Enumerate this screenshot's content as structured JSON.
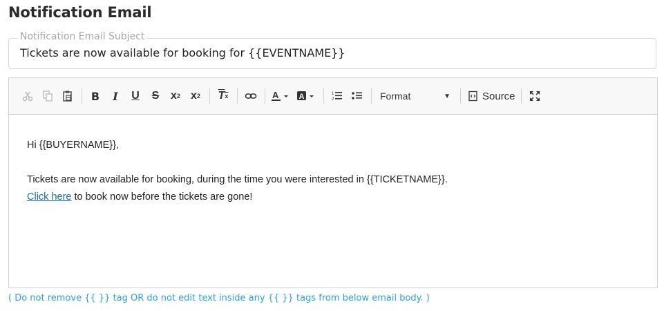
{
  "page_title": "Notification Email",
  "subject": {
    "label": "Notification Email Subject",
    "value": "Tickets are now available for booking for {{EVENTNAME}}"
  },
  "toolbar": {
    "buttons": [
      "cut-icon",
      "copy-icon",
      "paste-icon",
      "bold-icon",
      "italic-icon",
      "underline-icon",
      "strikethrough-icon",
      "subscript-icon",
      "superscript-icon",
      "remove-format-icon",
      "link-icon",
      "text-color-icon",
      "background-color-icon",
      "numbered-list-icon",
      "bulleted-list-icon",
      "maximize-icon"
    ],
    "format_label": "Format",
    "source_label": "Source"
  },
  "body": {
    "greeting": "Hi {{BUYERNAME}},",
    "line1": "Tickets are now available for booking, during the time you were interested in {{TICKETNAME}}.",
    "link_text": "Click here",
    "line2_rest": " to book now before the tickets are gone!"
  },
  "note": "( Do not remove {{ }} tag OR do not edit text inside any {{ }} tags from below email body. )"
}
